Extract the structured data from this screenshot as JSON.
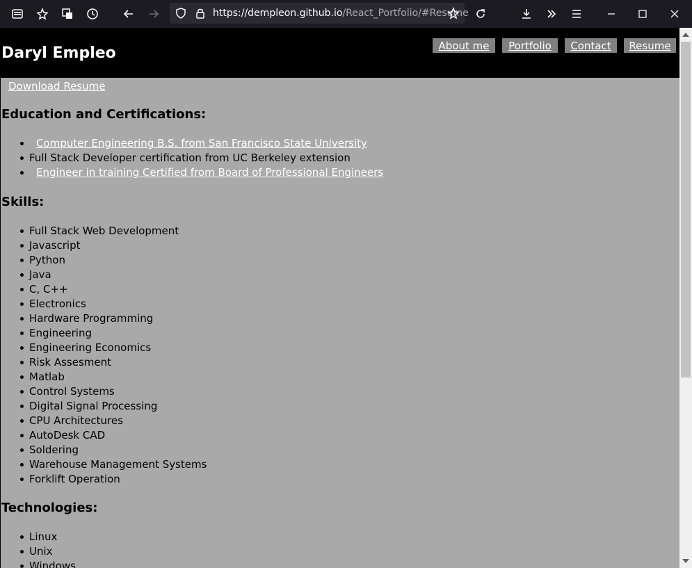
{
  "browser": {
    "url_host": "https://dempleon.github.io",
    "url_path": "/React_Portfolio/#Resume",
    "icons": [
      "sidebar-icon",
      "pocket-icon",
      "screenshot-icon",
      "history-icon",
      "back-icon",
      "forward-icon",
      "shield-icon",
      "lock-icon",
      "star-icon",
      "reload-icon",
      "download-icon",
      "overflow-icon",
      "menu-icon",
      "minimize-icon",
      "maximize-icon",
      "close-icon"
    ]
  },
  "header": {
    "title": "Daryl Empleo",
    "nav": [
      "About me",
      "Portfolio",
      "Contact",
      "Resume"
    ]
  },
  "resume": {
    "download_label": "Download Resume",
    "education_heading": "Education and Certifications:",
    "education": [
      {
        "text": "Computer Engineering B.S. from San Francisco State University",
        "link": true
      },
      {
        "text": "Full Stack Developer certification from UC Berkeley extension",
        "link": false
      },
      {
        "text": "Engineer in training Certified from Board of Professional Engineers",
        "link": true
      }
    ],
    "skills_heading": "Skills:",
    "skills": [
      "Full Stack Web Development",
      "Javascript",
      "Python",
      "Java",
      "C, C++",
      "Electronics",
      "Hardware Programming",
      "Engineering",
      "Engineering Economics",
      "Risk Assesment",
      "Matlab",
      "Control Systems",
      "Digital Signal Processing",
      "CPU Architectures",
      "AutoDesk CAD",
      "Soldering",
      "Warehouse Management Systems",
      "Forklift Operation"
    ],
    "technologies_heading": "Technologies:",
    "technologies": [
      "Linux",
      "Unix",
      "Windows"
    ]
  }
}
